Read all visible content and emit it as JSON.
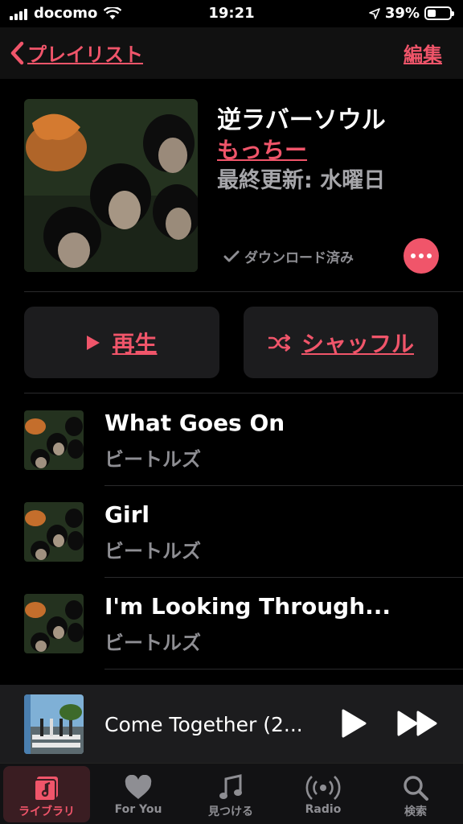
{
  "status_bar": {
    "carrier": "docomo",
    "time": "19:21",
    "battery_percent": "39%",
    "battery_level": 0.39
  },
  "nav": {
    "back_label": "プレイリスト",
    "edit_label": "編集"
  },
  "playlist": {
    "title": "逆ラバーソウル",
    "owner": "もっちー",
    "updated": "最終更新: 水曜日",
    "download_status": "ダウンロード済み"
  },
  "actions": {
    "play_label": "再生",
    "shuffle_label": "シャッフル"
  },
  "tracks": [
    {
      "title": "What Goes On",
      "artist": "ビートルズ"
    },
    {
      "title": "Girl",
      "artist": "ビートルズ"
    },
    {
      "title": "I'm Looking Through...",
      "artist": "ビートルズ"
    }
  ],
  "now_playing": {
    "title": "Come Together (2..."
  },
  "tabs": [
    {
      "label": "ライブラリ",
      "icon": "library-icon",
      "active": true
    },
    {
      "label": "For You",
      "icon": "heart-icon",
      "active": false
    },
    {
      "label": "見つける",
      "icon": "music-note-icon",
      "active": false
    },
    {
      "label": "Radio",
      "icon": "radio-icon",
      "active": false
    },
    {
      "label": "検索",
      "icon": "search-icon",
      "active": false
    }
  ],
  "colors": {
    "accent": "#f0556a",
    "background": "#000000",
    "button_bg": "#1c1c1e",
    "secondary_text": "#8e8e93"
  }
}
